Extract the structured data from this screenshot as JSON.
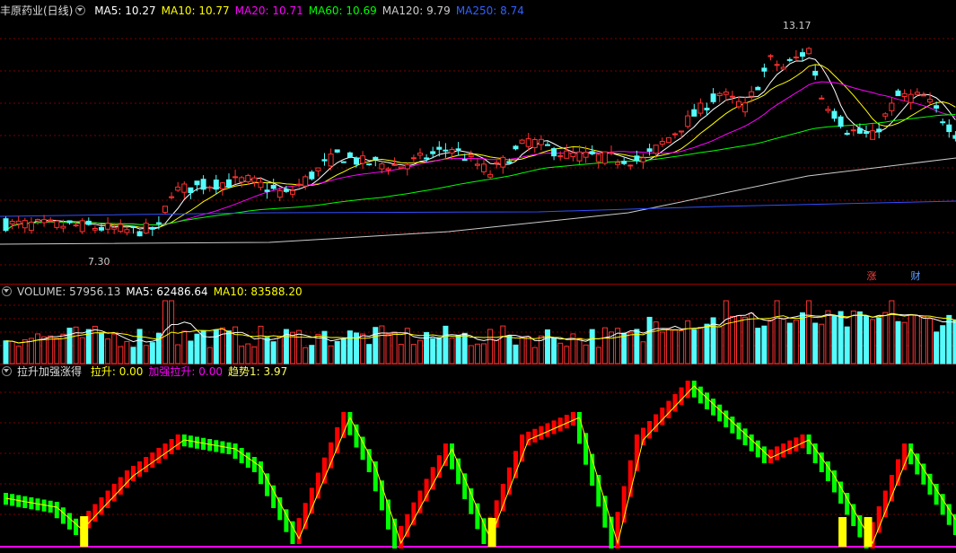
{
  "main": {
    "title": "丰原药业(日线)",
    "ma": [
      {
        "label": "MA5: 10.27",
        "color": "#ffffff"
      },
      {
        "label": "MA10: 10.77",
        "color": "#ffff00"
      },
      {
        "label": "MA20: 10.71",
        "color": "#ff00ff"
      },
      {
        "label": "MA60: 10.69",
        "color": "#00ff00"
      },
      {
        "label": "MA120: 9.79",
        "color": "#cccccc"
      },
      {
        "label": "MA250: 8.74",
        "color": "#3060ff"
      }
    ],
    "high_label": "13.17",
    "low_label": "7.30",
    "badge_zhang": "涨",
    "badge_cai": "财"
  },
  "volume": {
    "labels": [
      {
        "label": "VOLUME: 57956.13",
        "color": "#cccccc"
      },
      {
        "label": "MA5: 62486.64",
        "color": "#ffffff"
      },
      {
        "label": "MA10: 83588.20",
        "color": "#ffff00"
      }
    ]
  },
  "indicator": {
    "title": "拉升加强涨得",
    "labels": [
      {
        "label": "拉升: 0.00",
        "color": "#ffff00"
      },
      {
        "label": "加强拉升: 0.00",
        "color": "#ff00ff"
      },
      {
        "label": "趋势1: 3.97",
        "color": "#ffff66"
      }
    ]
  },
  "colors": {
    "up": "#ff3030",
    "down": "#54fcfc",
    "grid": "#7a0000",
    "border": "#a00000",
    "ind_up": "#ff0000",
    "ind_down": "#00ff00",
    "ind_line": "#ffff00"
  }
}
